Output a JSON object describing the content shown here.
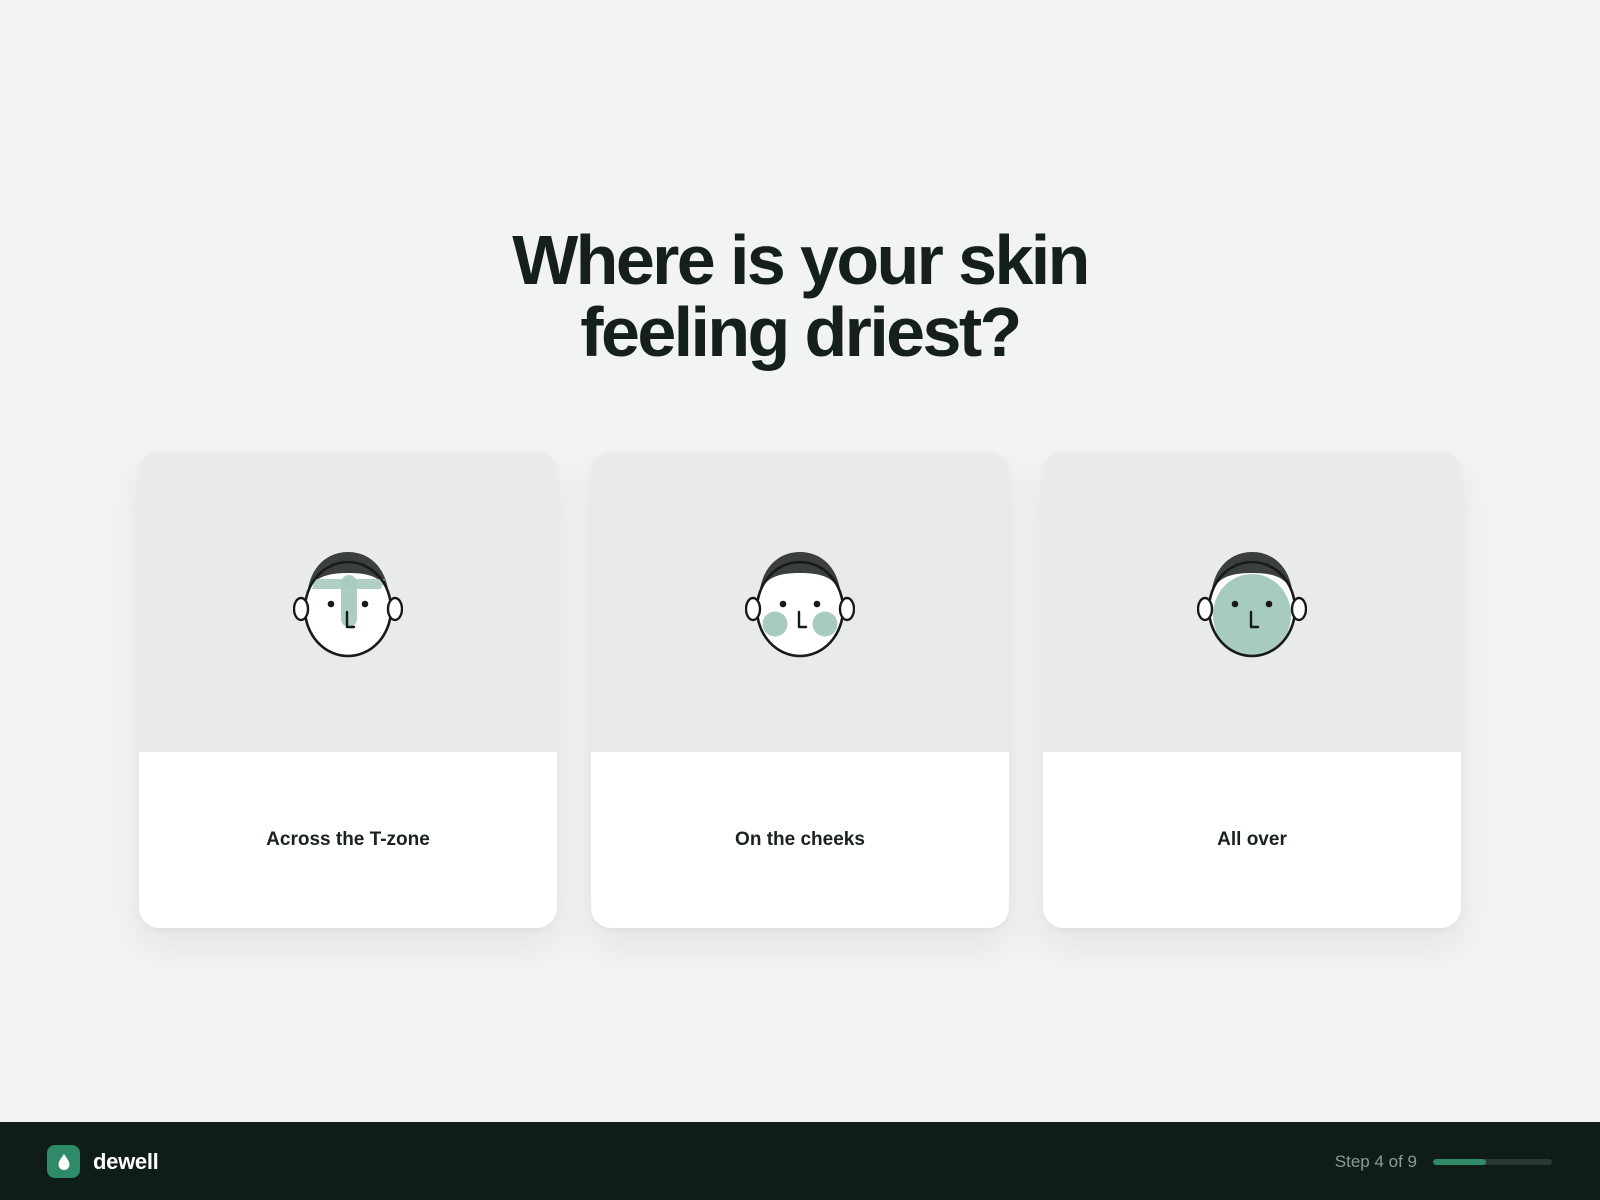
{
  "question": {
    "title": "Where is your skin feeling driest?"
  },
  "options": [
    {
      "label": "Across the T-zone",
      "icon": "face-t-zone-icon"
    },
    {
      "label": "On the cheeks",
      "icon": "face-cheeks-icon"
    },
    {
      "label": "All over",
      "icon": "face-all-over-icon"
    }
  ],
  "footer": {
    "brand": "dewell",
    "logo_icon": "droplet-icon",
    "step_text": "Step 4 of 9",
    "progress_fraction": 0.444
  },
  "colors": {
    "accent": "#2f8a67",
    "dry_zone": "#a7cbbd",
    "footer_bg": "#0f1d19",
    "page_bg": "#f2f4f3"
  }
}
